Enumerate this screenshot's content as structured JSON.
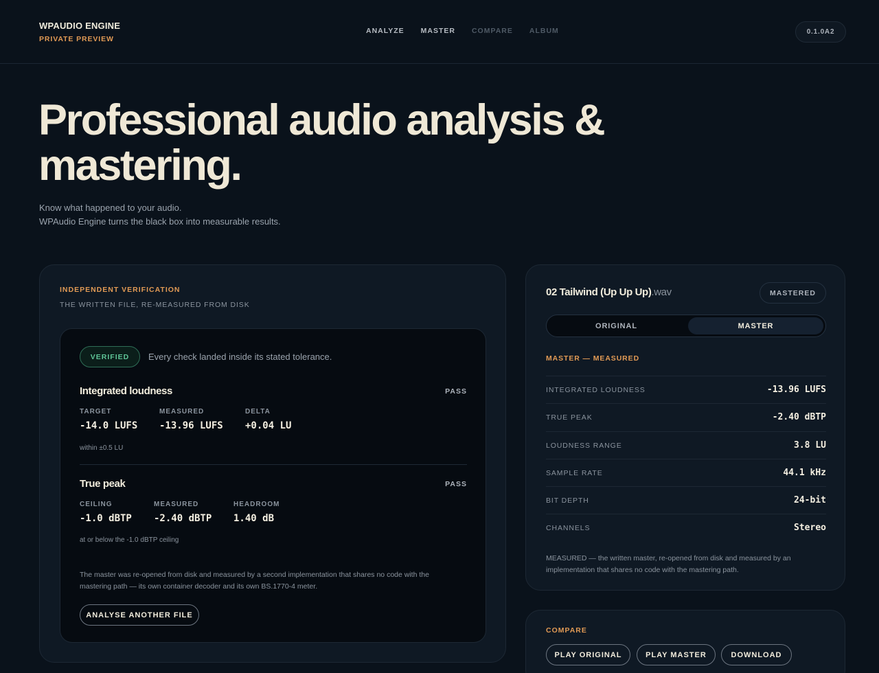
{
  "header": {
    "brand": "WPAUDIO ENGINE",
    "brand_sub": "PRIVATE PREVIEW",
    "nav": [
      "ANALYZE",
      "MASTER",
      "COMPARE",
      "ALBUM"
    ],
    "version": "0.1.0A2"
  },
  "hero": {
    "title_line1": "Professional audio analysis &",
    "title_line2": "mastering.",
    "desc_line1": "Know what happened to your audio.",
    "desc_line2": "WPAudio Engine turns the black box into measurable results."
  },
  "verification": {
    "eyebrow": "INDEPENDENT VERIFICATION",
    "subtitle": "THE WRITTEN FILE, RE-MEASURED FROM DISK",
    "badge": "VERIFIED",
    "message": "Every check landed inside its stated tolerance.",
    "checks": [
      {
        "title": "Integrated loudness",
        "status": "PASS",
        "metrics": [
          {
            "label": "TARGET",
            "value": "-14.0 LUFS"
          },
          {
            "label": "MEASURED",
            "value": "-13.96 LUFS"
          },
          {
            "label": "DELTA",
            "value": "+0.04 LU"
          }
        ],
        "note": "within ±0.5 LU"
      },
      {
        "title": "True peak",
        "status": "PASS",
        "metrics": [
          {
            "label": "CEILING",
            "value": "-1.0 dBTP"
          },
          {
            "label": "MEASURED",
            "value": "-2.40 dBTP"
          },
          {
            "label": "HEADROOM",
            "value": "1.40 dB"
          }
        ],
        "note": "at or below the -1.0 dBTP ceiling"
      }
    ],
    "footnote": "The master was re-opened from disk and measured by a second implementation that shares no code with the mastering path — its own container decoder and its own BS.1770-4 meter.",
    "button": "ANALYSE ANOTHER FILE"
  },
  "file": {
    "name": "02 Tailwind (Up Up Up)",
    "ext": ".wav",
    "badge": "MASTERED",
    "toggle": [
      "ORIGINAL",
      "MASTER"
    ],
    "toggle_selected": "MASTER",
    "section": "MASTER — MEASURED",
    "stats": [
      {
        "label": "INTEGRATED LOUDNESS",
        "value": "-13.96 LUFS"
      },
      {
        "label": "TRUE PEAK",
        "value": "-2.40 dBTP"
      },
      {
        "label": "LOUDNESS RANGE",
        "value": "3.8 LU"
      },
      {
        "label": "SAMPLE RATE",
        "value": "44.1 kHz"
      },
      {
        "label": "BIT DEPTH",
        "value": "24-bit"
      },
      {
        "label": "CHANNELS",
        "value": "Stereo"
      }
    ],
    "note": "MEASURED — the written master, re-opened from disk and measured by an implementation that shares no code with the mastering path."
  },
  "compare": {
    "eyebrow": "COMPARE",
    "buttons": [
      "PLAY ORIGINAL",
      "PLAY MASTER",
      "DOWNLOAD"
    ]
  }
}
